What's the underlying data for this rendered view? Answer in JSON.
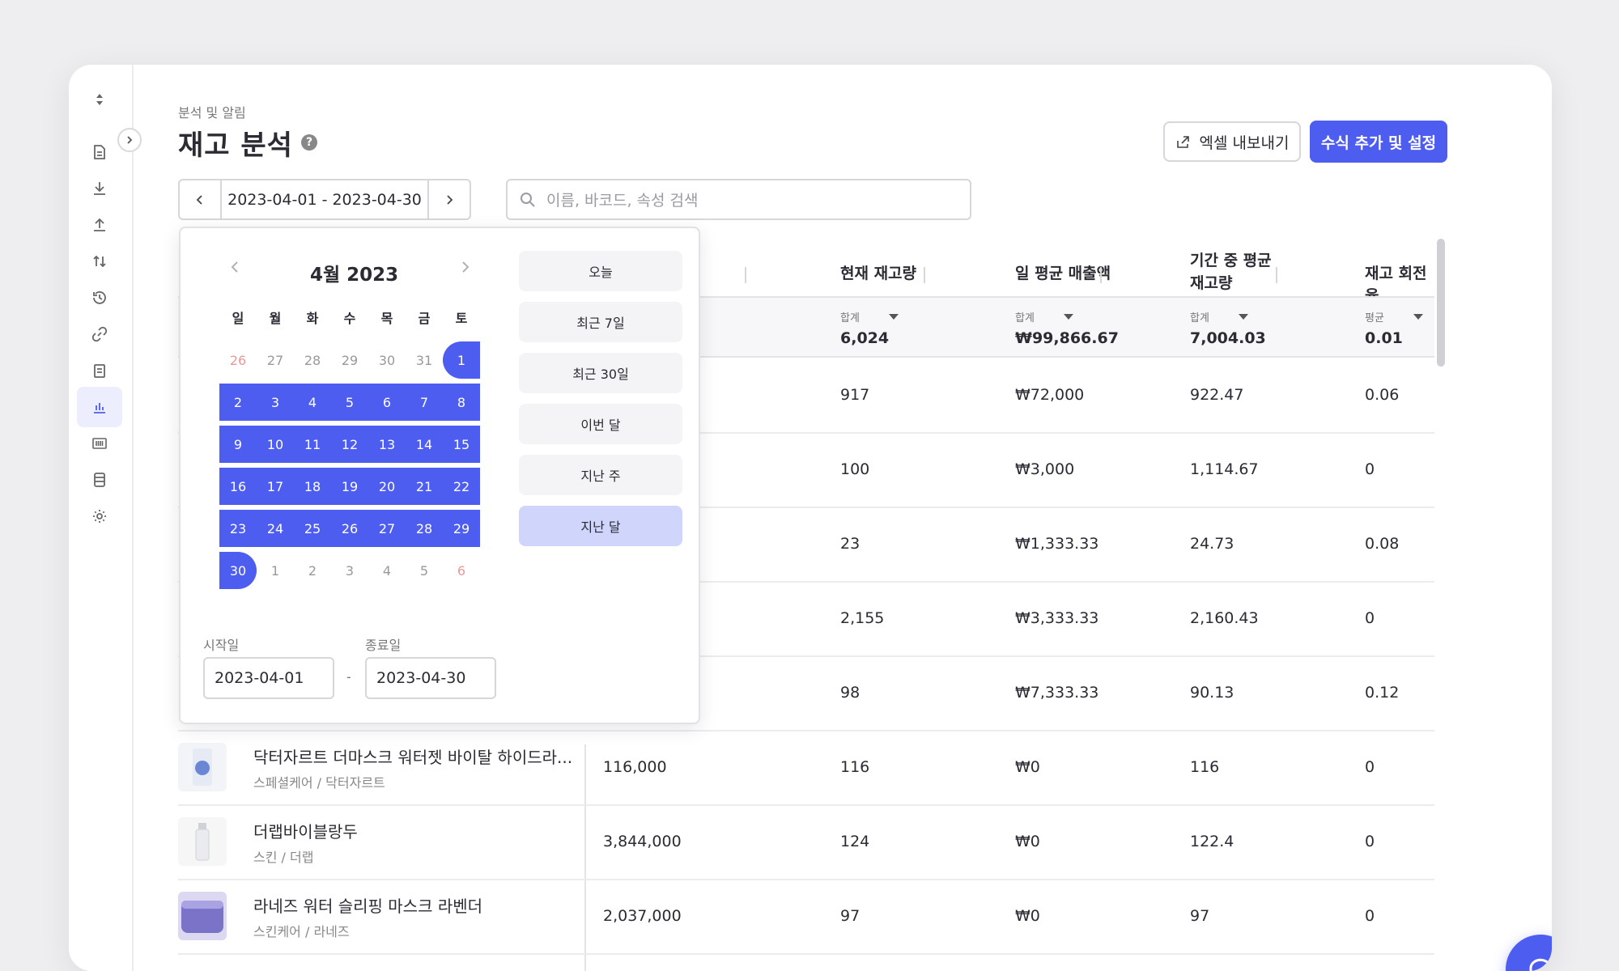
{
  "breadcrumb": "분석 및 알림",
  "title": "재고 분석",
  "help": "?",
  "buttons": {
    "export": "엑셀 내보내기",
    "formula": "수식 추가 및 설정"
  },
  "date_range": "2023-04-01 - 2023-04-30",
  "search": {
    "placeholder": "이름, 바코드, 속성 검색"
  },
  "table": {
    "columns": [
      "현재 재고량",
      "일 평균 매출액",
      "기간 중 평균\n재고량",
      "재고 회전율"
    ],
    "summary": [
      {
        "label": "합계",
        "value": "6,024"
      },
      {
        "label": "합계",
        "value": "₩99,866.67"
      },
      {
        "label": "합계",
        "value": "7,004.03"
      },
      {
        "label": "평균",
        "value": "0.01"
      }
    ],
    "rows": [
      {
        "name": "",
        "category": "",
        "col1": "",
        "stock": "917",
        "avg_sales": "₩72,000",
        "avg_stock": "922.47",
        "turnover": "0.06"
      },
      {
        "name": "",
        "category": "",
        "col1": "",
        "stock": "100",
        "avg_sales": "₩3,000",
        "avg_stock": "1,114.67",
        "turnover": "0"
      },
      {
        "name": "",
        "category": "",
        "col1": "",
        "stock": "23",
        "avg_sales": "₩1,333.33",
        "avg_stock": "24.73",
        "turnover": "0.08"
      },
      {
        "name": "",
        "category": "",
        "col1": "",
        "stock": "2,155",
        "avg_sales": "₩3,333.33",
        "avg_stock": "2,160.43",
        "turnover": "0"
      },
      {
        "name": "",
        "category": "",
        "col1": "",
        "stock": "98",
        "avg_sales": "₩7,333.33",
        "avg_stock": "90.13",
        "turnover": "0.12"
      },
      {
        "name": "닥터자르트 더마스크 워터젯 바이탈 하이드라...",
        "category": "스페셜케어 / 닥터자르트",
        "col1": "116,000",
        "stock": "116",
        "avg_sales": "₩0",
        "avg_stock": "116",
        "turnover": "0"
      },
      {
        "name": "더랩바이블랑두",
        "category": "스킨 / 더랩",
        "col1": "3,844,000",
        "stock": "124",
        "avg_sales": "₩0",
        "avg_stock": "122.4",
        "turnover": "0"
      },
      {
        "name": "라네즈 워터 슬리핑 마스크 라벤더",
        "category": "스킨케어 / 라네즈",
        "col1": "2,037,000",
        "stock": "97",
        "avg_sales": "₩0",
        "avg_stock": "97",
        "turnover": "0"
      }
    ]
  },
  "calendar": {
    "month_label": "4월 2023",
    "weekdays": [
      "일",
      "월",
      "화",
      "수",
      "목",
      "금",
      "토"
    ],
    "weeks": [
      [
        "26",
        "27",
        "28",
        "29",
        "30",
        "31",
        "1"
      ],
      [
        "2",
        "3",
        "4",
        "5",
        "6",
        "7",
        "8"
      ],
      [
        "9",
        "10",
        "11",
        "12",
        "13",
        "14",
        "15"
      ],
      [
        "16",
        "17",
        "18",
        "19",
        "20",
        "21",
        "22"
      ],
      [
        "23",
        "24",
        "25",
        "26",
        "27",
        "28",
        "29"
      ],
      [
        "30",
        "1",
        "2",
        "3",
        "4",
        "5",
        "6"
      ]
    ],
    "presets": [
      "오늘",
      "최근 7일",
      "최근 30일",
      "이번 달",
      "지난 주",
      "지난 달"
    ],
    "active_preset": "지난 달",
    "start_label": "시작일",
    "end_label": "종료일",
    "start_value": "2023-04-01",
    "end_value": "2023-04-30",
    "dash": "-"
  },
  "colors": {
    "accent": "#4d5df0",
    "preset_active": "#d0d6fb"
  },
  "icons": [
    "sort-icon",
    "document-icon",
    "download-icon",
    "upload-icon",
    "transfer-icon",
    "history-icon",
    "link-icon",
    "list-icon",
    "chart-icon",
    "barcode-icon",
    "database-icon",
    "settings-icon",
    "chat-icon"
  ]
}
